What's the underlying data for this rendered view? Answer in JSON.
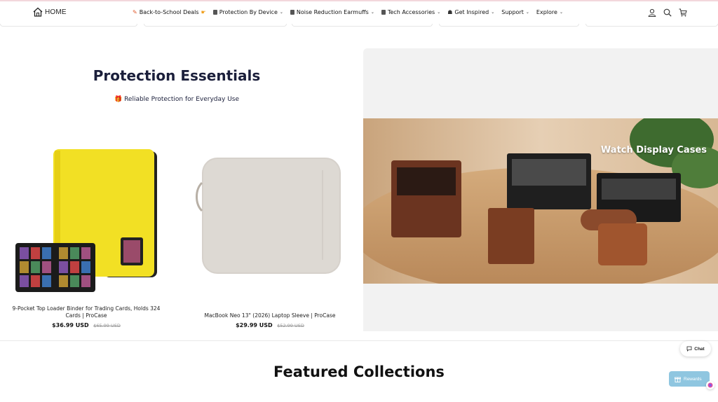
{
  "header": {
    "logo_text": "HOME",
    "nav": [
      {
        "label": "Back-to-School Deals",
        "icon": "pencil-icon",
        "has_chevron": false
      },
      {
        "label": "Protection By Device",
        "icon": "device-icon",
        "has_chevron": true
      },
      {
        "label": "Noise Reduction Earmuffs",
        "icon": "earmuff-icon",
        "has_chevron": true
      },
      {
        "label": "Tech Accessories",
        "icon": "accessory-icon",
        "has_chevron": true
      },
      {
        "label": "Get Inspired",
        "icon": "network-icon",
        "has_chevron": true
      },
      {
        "label": "Support",
        "icon": "",
        "has_chevron": true
      },
      {
        "label": "Explore",
        "icon": "",
        "has_chevron": true
      }
    ]
  },
  "section": {
    "title": "Protection Essentials",
    "subtitle": "Reliable Protection for Everyday Use"
  },
  "products": [
    {
      "name": "9-Pocket Top Loader Binder for Trading Cards, Holds 324 Cards | ProCase",
      "price": "$36.99 USD",
      "old_price": "$65.99 USD"
    },
    {
      "name": "MacBook Neo 13\" (2026) Laptop Sleeve | ProCase",
      "price": "$29.99 USD",
      "old_price": "$52.99 USD"
    }
  ],
  "banner": {
    "caption": "Watch Display Cases"
  },
  "featured": {
    "title": "Featured Collections"
  },
  "widgets": {
    "chat_label": "Chat",
    "rewards_label": "Rewards"
  },
  "colors": {
    "heading": "#1b1f3b",
    "banner_bg": "#f2f2f2",
    "rewards": "#8fc6e0"
  }
}
